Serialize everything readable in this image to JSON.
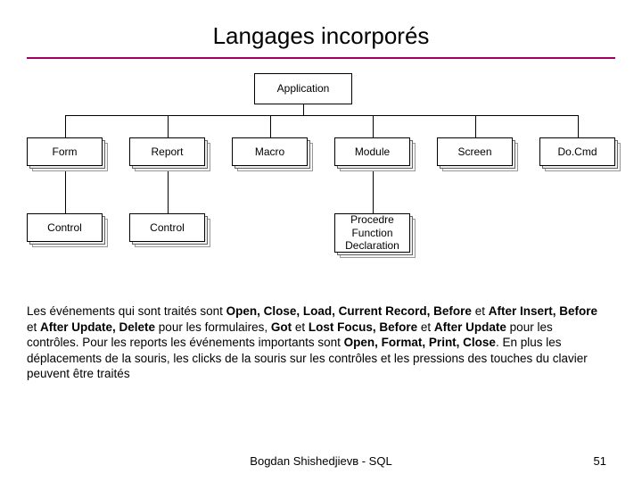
{
  "title": "Langages incorporés",
  "diagram": {
    "root": "Application",
    "row1": [
      "Form",
      "Report",
      "Macro",
      "Module",
      "Screen",
      "Do.Cmd"
    ],
    "row2": [
      "Control",
      "Control",
      "",
      "Procedre\nFunction\nDeclaration",
      "",
      ""
    ]
  },
  "description": {
    "parts": [
      {
        "t": "Les événements qui sont traités sont ",
        "b": false
      },
      {
        "t": "Open, Close, Load, Current Record, Before",
        "b": true
      },
      {
        "t": " et ",
        "b": false
      },
      {
        "t": "After Insert, Before",
        "b": true
      },
      {
        "t": " et ",
        "b": false
      },
      {
        "t": "After Update, Delete",
        "b": true
      },
      {
        "t": " pour les formulaires, ",
        "b": false
      },
      {
        "t": "Got",
        "b": true
      },
      {
        "t": " et ",
        "b": false
      },
      {
        "t": "Lost Focus, Before",
        "b": true
      },
      {
        "t": " et ",
        "b": false
      },
      {
        "t": "After Update",
        "b": true
      },
      {
        "t": " pour les contrôles. Pour les reports les événements importants sont ",
        "b": false
      },
      {
        "t": "Open, Format, Print, Close",
        "b": true
      },
      {
        "t": ". En plus les déplacements de la souris, les clicks de la souris sur les contrôles et les pressions des touches du clavier peuvent être traités",
        "b": false
      }
    ]
  },
  "footer": {
    "author": "Bogdan Shishedjievв - SQL",
    "page": "51"
  }
}
